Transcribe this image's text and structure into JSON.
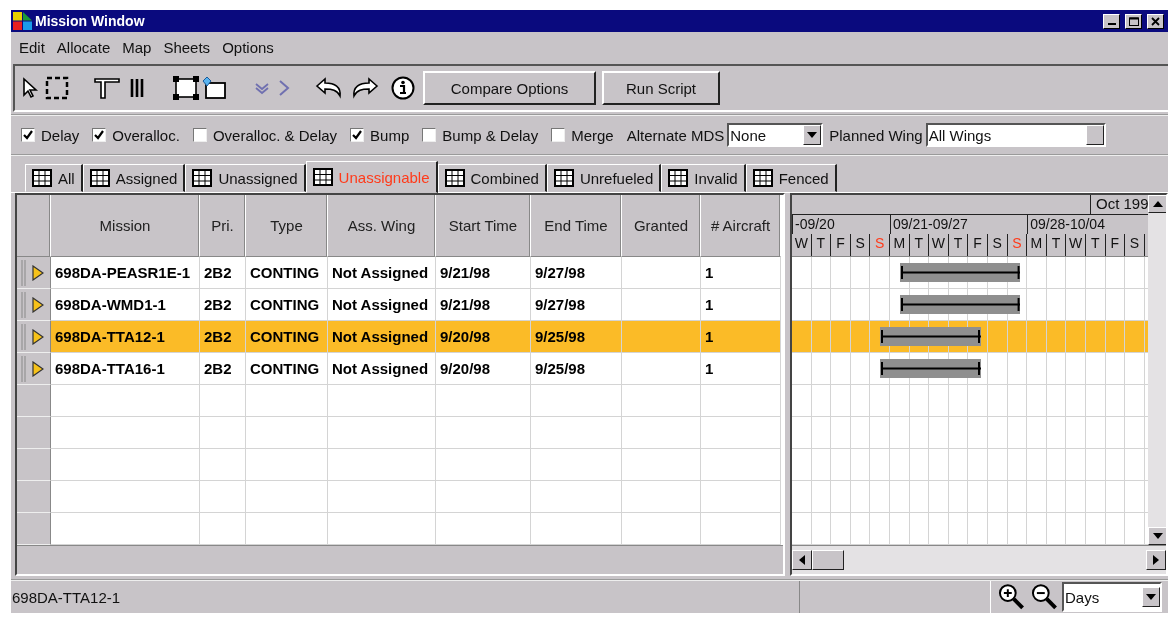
{
  "window": {
    "title": "Mission Window"
  },
  "menu": [
    "Edit",
    "Allocate",
    "Map",
    "Sheets",
    "Options"
  ],
  "toolbar": {
    "buttons": [
      "Compare Options",
      "Run Script"
    ]
  },
  "filters": [
    {
      "label": "Delay",
      "checked": true
    },
    {
      "label": "Overalloc.",
      "checked": true
    },
    {
      "label": "Overalloc. & Delay",
      "checked": false
    },
    {
      "label": "Bump",
      "checked": true
    },
    {
      "label": "Bump & Delay",
      "checked": false
    },
    {
      "label": "Merge",
      "checked": false
    }
  ],
  "alternate_mds": {
    "label": "Alternate MDS",
    "value": "None"
  },
  "planned_wing": {
    "label": "Planned Wing",
    "value": "All Wings"
  },
  "tabs": [
    {
      "label": "All",
      "selected": false
    },
    {
      "label": "Assigned",
      "selected": false
    },
    {
      "label": "Unassigned",
      "selected": false
    },
    {
      "label": "Unassignable",
      "selected": true
    },
    {
      "label": "Combined",
      "selected": false
    },
    {
      "label": "Unrefueled",
      "selected": false
    },
    {
      "label": "Invalid",
      "selected": false
    },
    {
      "label": "Fenced",
      "selected": false
    }
  ],
  "table": {
    "columns": [
      "Mission",
      "Pri.",
      "Type",
      "Ass. Wing",
      "Start Time",
      "End Time",
      "Granted",
      "# Aircraft"
    ],
    "rows": [
      {
        "cells": [
          "698DA-PEASR1E-1",
          "2B2",
          "CONTING",
          "Not Assigned",
          "9/21/98",
          "9/27/98",
          "",
          "1"
        ],
        "selected": false
      },
      {
        "cells": [
          "698DA-WMD1-1",
          "2B2",
          "CONTING",
          "Not Assigned",
          "9/21/98",
          "9/27/98",
          "",
          "1"
        ],
        "selected": false
      },
      {
        "cells": [
          "698DA-TTA12-1",
          "2B2",
          "CONTING",
          "Not Assigned",
          "9/20/98",
          "9/25/98",
          "",
          "1"
        ],
        "selected": true
      },
      {
        "cells": [
          "698DA-TTA16-1",
          "2B2",
          "CONTING",
          "Not Assigned",
          "9/20/98",
          "9/25/98",
          "",
          "1"
        ],
        "selected": false
      }
    ]
  },
  "gantt": {
    "month": "Oct 199",
    "weeks": [
      {
        "label": "-09/20",
        "days": [
          {
            "label": "W",
            "weekend": false
          },
          {
            "label": "T",
            "weekend": false
          },
          {
            "label": "F",
            "weekend": false
          },
          {
            "label": "S",
            "weekend": false
          },
          {
            "label": "S",
            "weekend": true
          }
        ]
      },
      {
        "label": "09/21-09/27",
        "days": [
          {
            "label": "M",
            "weekend": false
          },
          {
            "label": "T",
            "weekend": false
          },
          {
            "label": "W",
            "weekend": false
          },
          {
            "label": "T",
            "weekend": false
          },
          {
            "label": "F",
            "weekend": false
          },
          {
            "label": "S",
            "weekend": false
          },
          {
            "label": "S",
            "weekend": true
          }
        ]
      },
      {
        "label": "09/28-10/04",
        "days": [
          {
            "label": "M",
            "weekend": false
          },
          {
            "label": "T",
            "weekend": false
          },
          {
            "label": "W",
            "weekend": false
          },
          {
            "label": "T",
            "weekend": false
          },
          {
            "label": "F",
            "weekend": false
          },
          {
            "label": "S",
            "weekend": false
          }
        ]
      }
    ]
  },
  "status_bar": {
    "text": "698DA-TTA12-1",
    "scale": "Days"
  }
}
